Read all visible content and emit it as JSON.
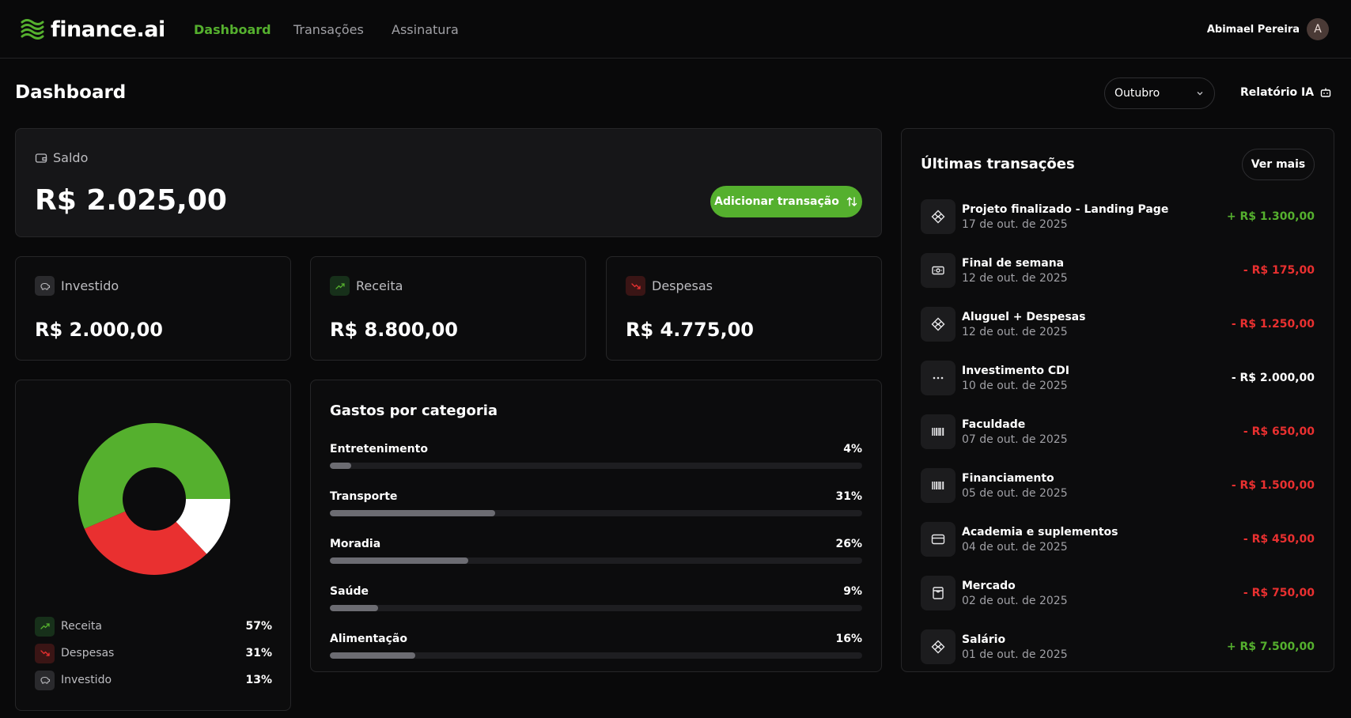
{
  "app": {
    "name": "finance.ai"
  },
  "nav": {
    "items": [
      {
        "label": "Dashboard",
        "active": true
      },
      {
        "label": "Transações",
        "active": false
      },
      {
        "label": "Assinatura",
        "active": false
      }
    ]
  },
  "user": {
    "name": "Abimael Pereira",
    "initial": "A"
  },
  "page": {
    "title": "Dashboard"
  },
  "toolbar": {
    "month": "Outubro",
    "report_label": "Relatório IA"
  },
  "balance": {
    "label": "Saldo",
    "value": "R$ 2.025,00",
    "add_label": "Adicionar transação"
  },
  "stats": [
    {
      "label": "Investido",
      "value": "R$ 2.000,00",
      "icon": "piggy-bank-icon"
    },
    {
      "label": "Receita",
      "value": "R$ 8.800,00",
      "icon": "trending-up-icon"
    },
    {
      "label": "Despesas",
      "value": "R$ 4.775,00",
      "icon": "trending-down-icon"
    }
  ],
  "chart_data": {
    "type": "pie",
    "donut": true,
    "slices": [
      {
        "label": "Receita",
        "value": 57,
        "pct_label": "57%",
        "color": "#55b02e"
      },
      {
        "label": "Despesas",
        "value": 31,
        "pct_label": "31%",
        "color": "#e93030"
      },
      {
        "label": "Investido",
        "value": 13,
        "pct_label": "13%",
        "color": "#ffffff"
      }
    ]
  },
  "categories": {
    "title": "Gastos por categoria",
    "items": [
      {
        "name": "Entretenimento",
        "pct": 4,
        "pct_label": "4%"
      },
      {
        "name": "Transporte",
        "pct": 31,
        "pct_label": "31%"
      },
      {
        "name": "Moradia",
        "pct": 26,
        "pct_label": "26%"
      },
      {
        "name": "Saúde",
        "pct": 9,
        "pct_label": "9%"
      },
      {
        "name": "Alimentação",
        "pct": 16,
        "pct_label": "16%"
      }
    ]
  },
  "transactions": {
    "title": "Últimas transações",
    "more_label": "Ver mais",
    "items": [
      {
        "name": "Projeto finalizado - Landing Page",
        "date": "17 de out. de 2025",
        "amount": "+ R$ 1.300,00",
        "kind": "pos",
        "icon": "pix-icon"
      },
      {
        "name": "Final de semana",
        "date": "12 de out. de 2025",
        "amount": "- R$ 175,00",
        "kind": "neg",
        "icon": "cash-icon"
      },
      {
        "name": "Aluguel + Despesas",
        "date": "12 de out. de 2025",
        "amount": "- R$ 1.250,00",
        "kind": "neg",
        "icon": "pix-icon"
      },
      {
        "name": "Investimento CDI",
        "date": "10 de out. de 2025",
        "amount": "- R$ 2.000,00",
        "kind": "neutral",
        "icon": "more-icon"
      },
      {
        "name": "Faculdade",
        "date": "07 de out. de 2025",
        "amount": "- R$ 650,00",
        "kind": "neg",
        "icon": "barcode-icon"
      },
      {
        "name": "Financiamento",
        "date": "05 de out. de 2025",
        "amount": "- R$ 1.500,00",
        "kind": "neg",
        "icon": "barcode-icon"
      },
      {
        "name": "Academia e suplementos",
        "date": "04 de out. de 2025",
        "amount": "- R$ 450,00",
        "kind": "neg",
        "icon": "credit-card-icon"
      },
      {
        "name": "Mercado",
        "date": "02 de out. de 2025",
        "amount": "- R$ 750,00",
        "kind": "neg",
        "icon": "receipt-icon"
      },
      {
        "name": "Salário",
        "date": "01 de out. de 2025",
        "amount": "+ R$ 7.500,00",
        "kind": "pos",
        "icon": "pix-icon"
      }
    ]
  },
  "colors": {
    "accent": "#55b02e",
    "danger": "#e93030",
    "background": "#09090a"
  }
}
